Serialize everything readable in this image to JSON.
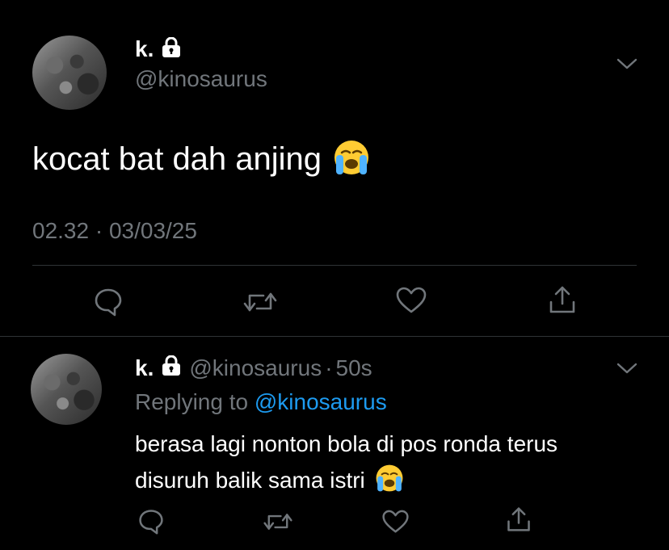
{
  "main_tweet": {
    "display_name": "k.",
    "handle": "@kinosaurus",
    "text": "kocat bat dah anjing",
    "emoji": "loudly-crying-face",
    "timestamp": "02.32 · 03/03/25",
    "actions": [
      "reply",
      "retweet",
      "like",
      "share"
    ]
  },
  "reply_tweet": {
    "display_name": "k.",
    "handle": "@kinosaurus",
    "separator": "·",
    "time_ago": "50s",
    "replying_prefix": "Replying to",
    "replying_handle": "@kinosaurus",
    "text_line1": "berasa lagi nonton bola di pos ronda terus",
    "text_line2": "disuruh balik sama istri",
    "emoji": "loudly-crying-face",
    "actions": [
      "reply",
      "retweet",
      "like",
      "share"
    ]
  },
  "colors": {
    "background": "#000000",
    "text": "#e7e9ea",
    "muted": "#71767b",
    "link": "#1d9bf0",
    "divider": "#2f3336"
  }
}
